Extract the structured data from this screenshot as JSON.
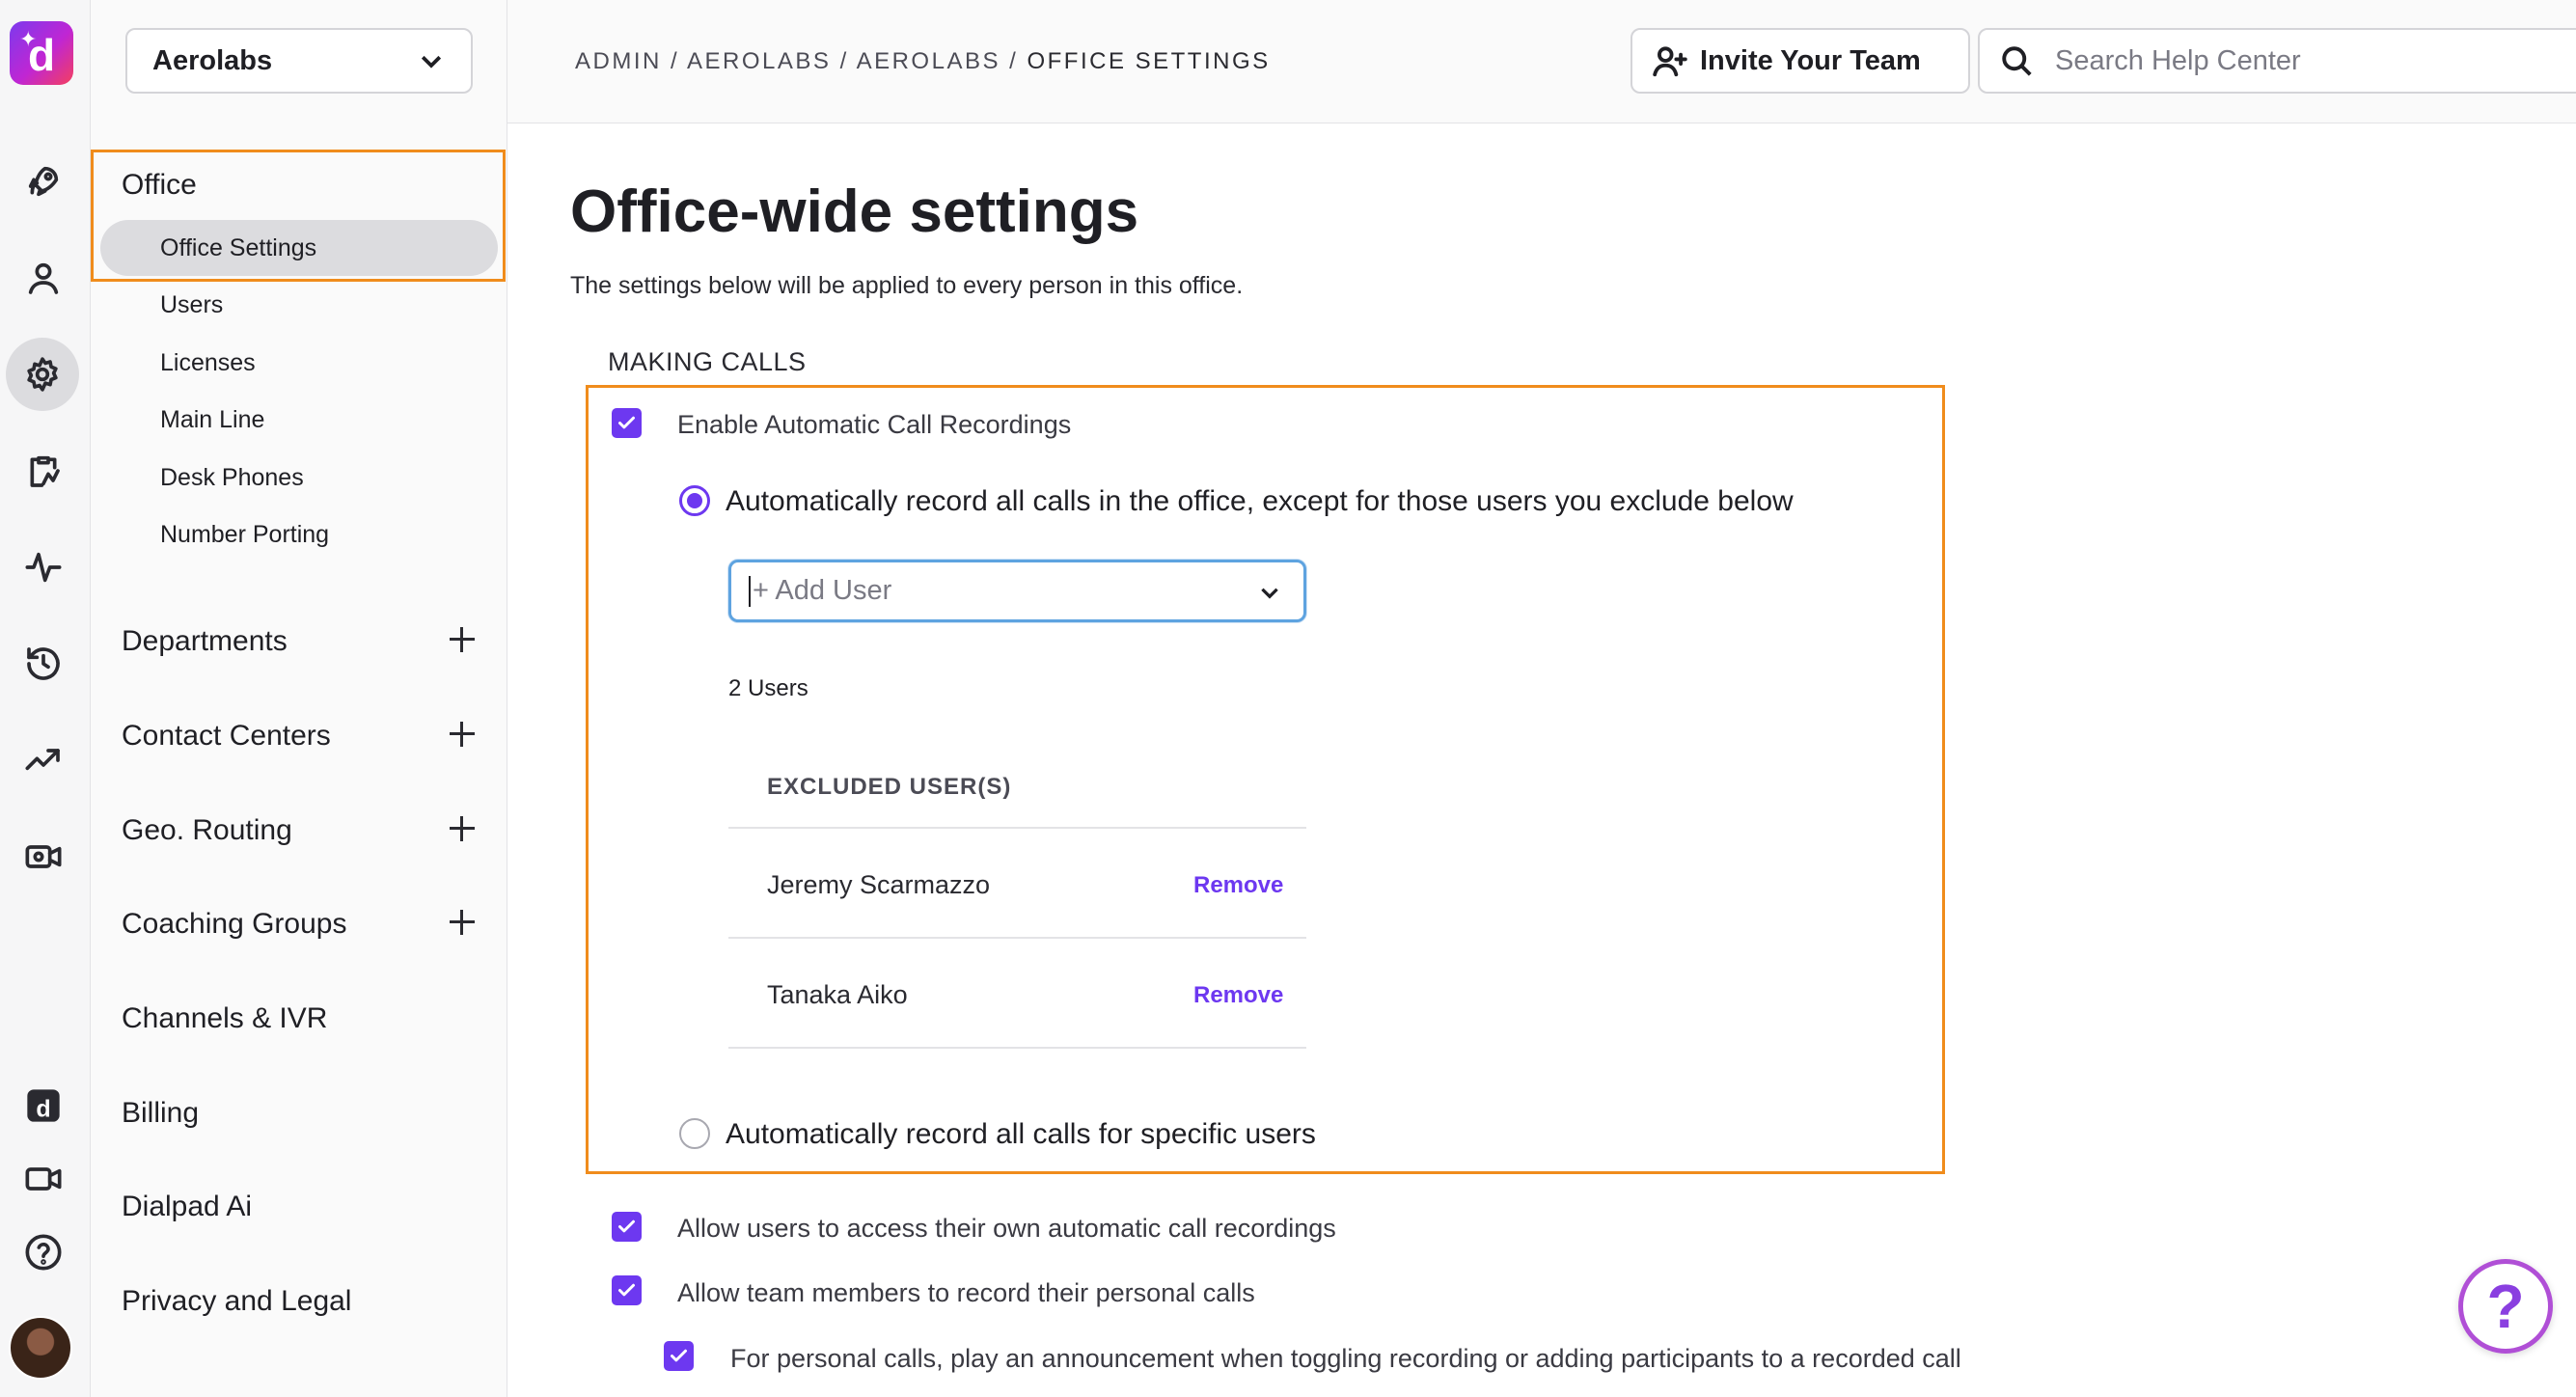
{
  "app": {
    "logo_letter": "d"
  },
  "sidebar": {
    "org": "Aerolabs",
    "office": {
      "title": "Office",
      "items": [
        "Office Settings",
        "Users",
        "Licenses",
        "Main Line",
        "Desk Phones",
        "Number Porting"
      ]
    },
    "groups": [
      "Departments",
      "Contact Centers",
      "Geo. Routing",
      "Coaching Groups",
      "Channels & IVR",
      "Billing",
      "Dialpad Ai",
      "Privacy and Legal"
    ]
  },
  "header": {
    "breadcrumb": "ADMIN / AEROLABS / AEROLABS / ",
    "breadcrumb_current": "OFFICE SETTINGS",
    "invite_label": "Invite Your Team",
    "search_placeholder": "Search Help Center"
  },
  "main": {
    "title": "Office-wide settings",
    "description": "The settings below will be applied to every person in this office.",
    "section": "MAKING CALLS",
    "recording": {
      "enable_label": "Enable Automatic Call Recordings",
      "option_all": "Automatically record all calls in the office, except for those users you exclude below",
      "add_user_placeholder": "+ Add User",
      "user_count": "2 Users",
      "table_header": "EXCLUDED USER(S)",
      "users": [
        {
          "name": "Jeremy Scarmazzo",
          "action": "Remove"
        },
        {
          "name": "Tanaka Aiko",
          "action": "Remove"
        }
      ],
      "option_specific": "Automatically record all calls for specific users"
    },
    "allow_access_label": "Allow users to access their own automatic call recordings",
    "allow_personal_label": "Allow team members to record their personal calls",
    "announcement_label": "For personal calls, play an announcement when toggling recording or adding participants to a recorded call"
  },
  "help_fab": "?",
  "colors": {
    "accent": "#6d38f0",
    "highlight": "#f08c1c",
    "focus": "#5ea3e0"
  }
}
